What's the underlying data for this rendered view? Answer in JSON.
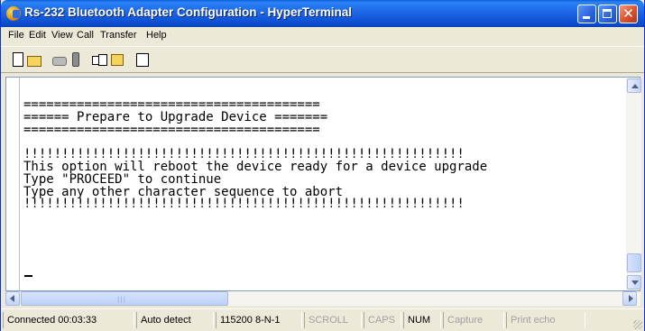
{
  "window": {
    "title": "Rs-232 Bluetooth Adapter Configuration - HyperTerminal"
  },
  "menu": {
    "items": [
      "File",
      "Edit",
      "View",
      "Call",
      "Transfer",
      "Help"
    ]
  },
  "toolbar": {
    "icons": [
      "new-file-icon",
      "open-folder-icon",
      "disconnect-icon",
      "dial-icon",
      "send-icon",
      "receive-icon",
      "properties-icon"
    ]
  },
  "terminal": {
    "lines": [
      "=======================================",
      "====== Prepare to Upgrade Device =======",
      "=======================================",
      "",
      "!!!!!!!!!!!!!!!!!!!!!!!!!!!!!!!!!!!!!!!!!!!!!!!!!!!!!!!!!!",
      "This option will reboot the device ready for a device upgrade",
      "Type \"PROCEED\" to continue",
      "Type any other character sequence to abort",
      "!!!!!!!!!!!!!!!!!!!!!!!!!!!!!!!!!!!!!!!!!!!!!!!!!!!!!!!!!!",
      "",
      ""
    ]
  },
  "status": {
    "connected": "Connected 00:03:33",
    "detect": "Auto detect",
    "baud": "115200 8-N-1",
    "scroll": "SCROLL",
    "caps": "CAPS",
    "num": "NUM",
    "capture": "Capture",
    "print_echo": "Print echo"
  },
  "colors": {
    "title_bar": "#0b4fd0",
    "terminal_bg": "#ffffff",
    "window_face": "#ece9d8"
  }
}
